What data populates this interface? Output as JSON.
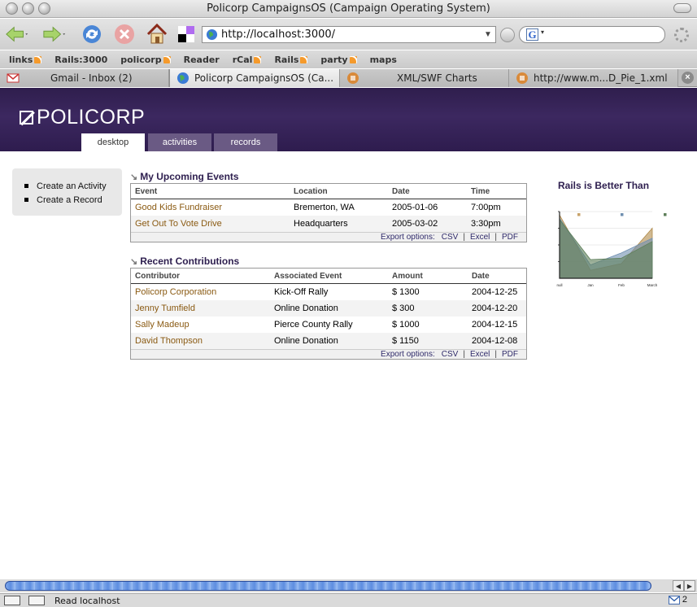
{
  "window": {
    "title": "Policorp CampaignsOS (Campaign Operating System)"
  },
  "navbar": {
    "url": "http://localhost:3000/"
  },
  "bookmarks": [
    {
      "label": "links",
      "rss": true
    },
    {
      "label": "Rails:3000",
      "rss": false
    },
    {
      "label": "policorp",
      "rss": true
    },
    {
      "label": "Reader",
      "rss": false
    },
    {
      "label": "rCal",
      "rss": true
    },
    {
      "label": "Rails",
      "rss": true
    },
    {
      "label": "party",
      "rss": true
    },
    {
      "label": "maps",
      "rss": false
    }
  ],
  "tabs": [
    {
      "label": "Gmail - Inbox (2)",
      "icon": "gmail-icon",
      "active": false
    },
    {
      "label": "Policorp CampaignsOS (Ca...",
      "icon": "globe-icon",
      "active": true
    },
    {
      "label": "XML/SWF Charts",
      "icon": "swf-icon",
      "active": false
    },
    {
      "label": "http://www.m...D_Pie_1.xml",
      "icon": "swf-icon",
      "active": false
    }
  ],
  "app": {
    "logo": "POLICORP",
    "tabs": [
      "desktop",
      "activities",
      "records"
    ],
    "active_tab": "desktop"
  },
  "sidebar": {
    "items": [
      "Create an Activity",
      "Create a Record"
    ]
  },
  "events": {
    "title": "My Upcoming Events",
    "headers": [
      "Event",
      "Location",
      "Date",
      "Time"
    ],
    "rows": [
      [
        "Good Kids Fundraiser",
        "Bremerton, WA",
        "2005-01-06",
        "7:00pm"
      ],
      [
        "Get Out To Vote Drive",
        "Headquarters",
        "2005-03-02",
        "3:30pm"
      ]
    ],
    "export_label": "Export options:",
    "export_options": [
      "CSV",
      "Excel",
      "PDF"
    ]
  },
  "contributions": {
    "title": "Recent Contributions",
    "headers": [
      "Contributor",
      "Associated Event",
      "Amount",
      "Date"
    ],
    "rows": [
      [
        "Policorp Corporation",
        "Kick-Off Rally",
        "$ 1300",
        "2004-12-25"
      ],
      [
        "Jenny Tumfield",
        "Online Donation",
        "$ 300",
        "2004-12-20"
      ],
      [
        "Sally Madeup",
        "Pierce County Rally",
        "$ 1000",
        "2004-12-15"
      ],
      [
        "David Thompson",
        "Online Donation",
        "$ 1150",
        "2004-12-08"
      ]
    ],
    "export_label": "Export options:",
    "export_options": [
      "CSV",
      "Excel",
      "PDF"
    ]
  },
  "chart_data": {
    "type": "area",
    "title": "Rails is Better Than",
    "categories": [
      "null",
      "Jan",
      "Feb",
      "March"
    ],
    "ylim": [
      0,
      100
    ],
    "series": [
      {
        "values": [
          95,
          12,
          22,
          75
        ],
        "color": "#b08a4a"
      },
      {
        "values": [
          90,
          20,
          38,
          60
        ],
        "color": "#6f8fb0"
      },
      {
        "values": [
          88,
          28,
          30,
          55
        ],
        "color": "#5e7f5a"
      }
    ],
    "legend_colors": [
      "#c8a26a",
      "#6f8fb0",
      "#5e7f5a"
    ],
    "grid": true
  },
  "status": {
    "text": "Read localhost",
    "mail_count": "2"
  },
  "colors": {
    "header": "#35234f",
    "link": "#8a5a12",
    "title": "#2f2050"
  }
}
